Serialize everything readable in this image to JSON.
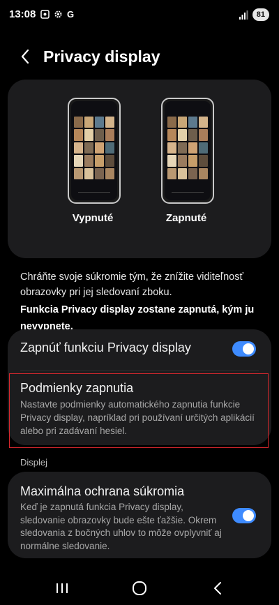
{
  "status_bar": {
    "time": "13:08",
    "g_label": "G",
    "battery": "81",
    "icons": [
      "screenshot-icon",
      "settings-status-icon",
      "google-icon",
      "signal-icon",
      "battery-icon"
    ]
  },
  "header": {
    "title": "Privacy display",
    "back_icon": "back-arrow-icon"
  },
  "preview": {
    "off_label": "Vypnuté",
    "on_label": "Zapnuté"
  },
  "description": {
    "text": "Chráňte svoje súkromie tým, že znížite viditeľnosť obrazovky pri jej sledovaní zboku.",
    "bold_text": "Funkcia Privacy display zostane zapnutá, kým ju nevypnete."
  },
  "settings": {
    "toggle_label": "Zapnúť funkciu Privacy display",
    "toggle_on": true,
    "conditions_title": "Podmienky zapnutia",
    "conditions_desc": "Nastavte podmienky automatického zapnutia funkcie Privacy display, napríklad pri používaní určitých aplikácií alebo pri zadávaní hesiel."
  },
  "section": {
    "label": "Displej"
  },
  "max_protection": {
    "title": "Maximálna ochrana súkromia",
    "desc": "Keď je zapnutá funkcia Privacy display, sledovanie obrazovky bude ešte ťažšie. Okrem sledovania z bočných uhlov to môže ovplyvniť aj normálne sledovanie.",
    "toggle_on": true
  },
  "nav": {
    "icons": [
      "recent-apps-icon",
      "home-icon",
      "back-icon"
    ]
  },
  "colors": {
    "accent": "#3e8bff",
    "card": "#1c1c1e",
    "highlight": "#d9282e"
  }
}
